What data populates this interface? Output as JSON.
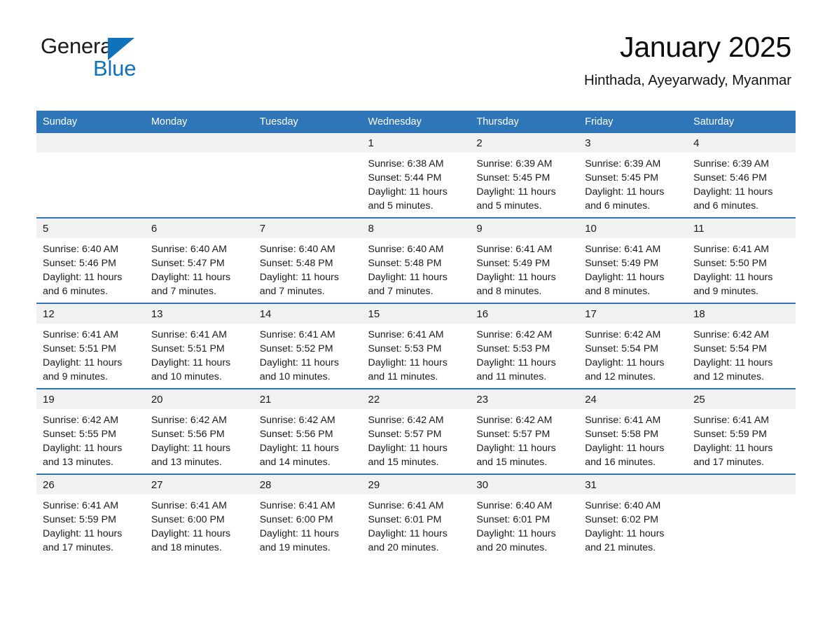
{
  "brand": {
    "name_top": "General",
    "name_bottom": "Blue",
    "accent_color": "#1072bb",
    "triangle_icon": "brand-triangle-icon"
  },
  "header": {
    "title": "January 2025",
    "subtitle": "Hinthada, Ayeyarwady, Myanmar"
  },
  "theme": {
    "header_blue": "#2e76b8",
    "day_band_gray": "#f1f1f1",
    "text_black": "#1a1a1a"
  },
  "weekdays": [
    "Sunday",
    "Monday",
    "Tuesday",
    "Wednesday",
    "Thursday",
    "Friday",
    "Saturday"
  ],
  "labels": {
    "sunrise_prefix": "Sunrise:",
    "sunset_prefix": "Sunset:",
    "daylight_prefix": "Daylight:"
  },
  "weeks": [
    [
      {
        "day": "",
        "empty": true
      },
      {
        "day": "",
        "empty": true
      },
      {
        "day": "",
        "empty": true
      },
      {
        "day": "1",
        "sunrise": "Sunrise: 6:38 AM",
        "sunset": "Sunset: 5:44 PM",
        "daylight_1": "Daylight: 11 hours",
        "daylight_2": "and 5 minutes."
      },
      {
        "day": "2",
        "sunrise": "Sunrise: 6:39 AM",
        "sunset": "Sunset: 5:45 PM",
        "daylight_1": "Daylight: 11 hours",
        "daylight_2": "and 5 minutes."
      },
      {
        "day": "3",
        "sunrise": "Sunrise: 6:39 AM",
        "sunset": "Sunset: 5:45 PM",
        "daylight_1": "Daylight: 11 hours",
        "daylight_2": "and 6 minutes."
      },
      {
        "day": "4",
        "sunrise": "Sunrise: 6:39 AM",
        "sunset": "Sunset: 5:46 PM",
        "daylight_1": "Daylight: 11 hours",
        "daylight_2": "and 6 minutes."
      }
    ],
    [
      {
        "day": "5",
        "sunrise": "Sunrise: 6:40 AM",
        "sunset": "Sunset: 5:46 PM",
        "daylight_1": "Daylight: 11 hours",
        "daylight_2": "and 6 minutes."
      },
      {
        "day": "6",
        "sunrise": "Sunrise: 6:40 AM",
        "sunset": "Sunset: 5:47 PM",
        "daylight_1": "Daylight: 11 hours",
        "daylight_2": "and 7 minutes."
      },
      {
        "day": "7",
        "sunrise": "Sunrise: 6:40 AM",
        "sunset": "Sunset: 5:48 PM",
        "daylight_1": "Daylight: 11 hours",
        "daylight_2": "and 7 minutes."
      },
      {
        "day": "8",
        "sunrise": "Sunrise: 6:40 AM",
        "sunset": "Sunset: 5:48 PM",
        "daylight_1": "Daylight: 11 hours",
        "daylight_2": "and 7 minutes."
      },
      {
        "day": "9",
        "sunrise": "Sunrise: 6:41 AM",
        "sunset": "Sunset: 5:49 PM",
        "daylight_1": "Daylight: 11 hours",
        "daylight_2": "and 8 minutes."
      },
      {
        "day": "10",
        "sunrise": "Sunrise: 6:41 AM",
        "sunset": "Sunset: 5:49 PM",
        "daylight_1": "Daylight: 11 hours",
        "daylight_2": "and 8 minutes."
      },
      {
        "day": "11",
        "sunrise": "Sunrise: 6:41 AM",
        "sunset": "Sunset: 5:50 PM",
        "daylight_1": "Daylight: 11 hours",
        "daylight_2": "and 9 minutes."
      }
    ],
    [
      {
        "day": "12",
        "sunrise": "Sunrise: 6:41 AM",
        "sunset": "Sunset: 5:51 PM",
        "daylight_1": "Daylight: 11 hours",
        "daylight_2": "and 9 minutes."
      },
      {
        "day": "13",
        "sunrise": "Sunrise: 6:41 AM",
        "sunset": "Sunset: 5:51 PM",
        "daylight_1": "Daylight: 11 hours",
        "daylight_2": "and 10 minutes."
      },
      {
        "day": "14",
        "sunrise": "Sunrise: 6:41 AM",
        "sunset": "Sunset: 5:52 PM",
        "daylight_1": "Daylight: 11 hours",
        "daylight_2": "and 10 minutes."
      },
      {
        "day": "15",
        "sunrise": "Sunrise: 6:41 AM",
        "sunset": "Sunset: 5:53 PM",
        "daylight_1": "Daylight: 11 hours",
        "daylight_2": "and 11 minutes."
      },
      {
        "day": "16",
        "sunrise": "Sunrise: 6:42 AM",
        "sunset": "Sunset: 5:53 PM",
        "daylight_1": "Daylight: 11 hours",
        "daylight_2": "and 11 minutes."
      },
      {
        "day": "17",
        "sunrise": "Sunrise: 6:42 AM",
        "sunset": "Sunset: 5:54 PM",
        "daylight_1": "Daylight: 11 hours",
        "daylight_2": "and 12 minutes."
      },
      {
        "day": "18",
        "sunrise": "Sunrise: 6:42 AM",
        "sunset": "Sunset: 5:54 PM",
        "daylight_1": "Daylight: 11 hours",
        "daylight_2": "and 12 minutes."
      }
    ],
    [
      {
        "day": "19",
        "sunrise": "Sunrise: 6:42 AM",
        "sunset": "Sunset: 5:55 PM",
        "daylight_1": "Daylight: 11 hours",
        "daylight_2": "and 13 minutes."
      },
      {
        "day": "20",
        "sunrise": "Sunrise: 6:42 AM",
        "sunset": "Sunset: 5:56 PM",
        "daylight_1": "Daylight: 11 hours",
        "daylight_2": "and 13 minutes."
      },
      {
        "day": "21",
        "sunrise": "Sunrise: 6:42 AM",
        "sunset": "Sunset: 5:56 PM",
        "daylight_1": "Daylight: 11 hours",
        "daylight_2": "and 14 minutes."
      },
      {
        "day": "22",
        "sunrise": "Sunrise: 6:42 AM",
        "sunset": "Sunset: 5:57 PM",
        "daylight_1": "Daylight: 11 hours",
        "daylight_2": "and 15 minutes."
      },
      {
        "day": "23",
        "sunrise": "Sunrise: 6:42 AM",
        "sunset": "Sunset: 5:57 PM",
        "daylight_1": "Daylight: 11 hours",
        "daylight_2": "and 15 minutes."
      },
      {
        "day": "24",
        "sunrise": "Sunrise: 6:41 AM",
        "sunset": "Sunset: 5:58 PM",
        "daylight_1": "Daylight: 11 hours",
        "daylight_2": "and 16 minutes."
      },
      {
        "day": "25",
        "sunrise": "Sunrise: 6:41 AM",
        "sunset": "Sunset: 5:59 PM",
        "daylight_1": "Daylight: 11 hours",
        "daylight_2": "and 17 minutes."
      }
    ],
    [
      {
        "day": "26",
        "sunrise": "Sunrise: 6:41 AM",
        "sunset": "Sunset: 5:59 PM",
        "daylight_1": "Daylight: 11 hours",
        "daylight_2": "and 17 minutes."
      },
      {
        "day": "27",
        "sunrise": "Sunrise: 6:41 AM",
        "sunset": "Sunset: 6:00 PM",
        "daylight_1": "Daylight: 11 hours",
        "daylight_2": "and 18 minutes."
      },
      {
        "day": "28",
        "sunrise": "Sunrise: 6:41 AM",
        "sunset": "Sunset: 6:00 PM",
        "daylight_1": "Daylight: 11 hours",
        "daylight_2": "and 19 minutes."
      },
      {
        "day": "29",
        "sunrise": "Sunrise: 6:41 AM",
        "sunset": "Sunset: 6:01 PM",
        "daylight_1": "Daylight: 11 hours",
        "daylight_2": "and 20 minutes."
      },
      {
        "day": "30",
        "sunrise": "Sunrise: 6:40 AM",
        "sunset": "Sunset: 6:01 PM",
        "daylight_1": "Daylight: 11 hours",
        "daylight_2": "and 20 minutes."
      },
      {
        "day": "31",
        "sunrise": "Sunrise: 6:40 AM",
        "sunset": "Sunset: 6:02 PM",
        "daylight_1": "Daylight: 11 hours",
        "daylight_2": "and 21 minutes."
      },
      {
        "day": "",
        "empty": true
      }
    ]
  ]
}
